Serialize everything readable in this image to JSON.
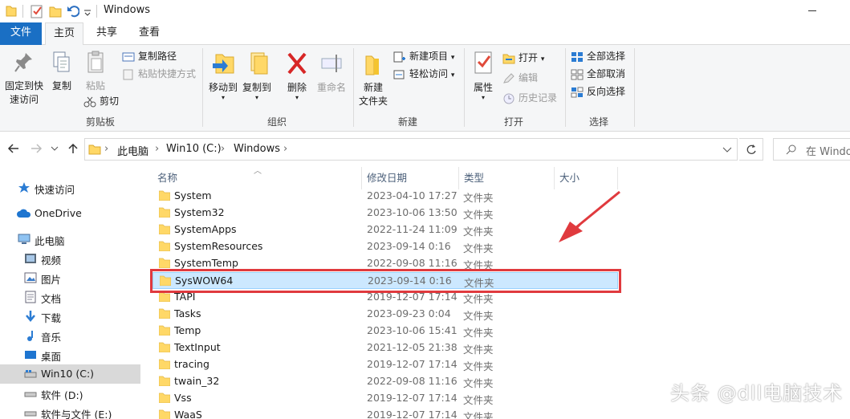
{
  "window": {
    "title": "Windows"
  },
  "ribbon_tabs": [
    "文件",
    "主页",
    "共享",
    "查看"
  ],
  "clipboard": {
    "pin_label_1": "固定到快",
    "pin_label_2": "速访问",
    "copy": "复制",
    "paste": "粘贴",
    "copy_path": "复制路径",
    "paste_shortcut": "粘贴快捷方式",
    "cut": "剪切",
    "group": "剪贴板"
  },
  "organize": {
    "move_to": "移动到",
    "copy_to": "复制到",
    "delete": "删除",
    "rename": "重命名",
    "group": "组织"
  },
  "new_group": {
    "new_folder_1": "新建",
    "new_folder_2": "文件夹",
    "new_item": "新建项目",
    "easy_access": "轻松访问",
    "group": "新建"
  },
  "open_group": {
    "properties": "属性",
    "open": "打开",
    "edit": "编辑",
    "history": "历史记录",
    "group": "打开"
  },
  "select_group": {
    "select_all": "全部选择",
    "select_none": "全部取消",
    "invert": "反向选择",
    "group": "选择"
  },
  "address": {
    "crumbs": [
      "此电脑",
      "Win10 (C:)",
      "Windows"
    ],
    "search_placeholder": "在 Windo"
  },
  "sidebar": {
    "items": [
      {
        "label": "快速访问",
        "icon": "star-icon"
      },
      {
        "label": "OneDrive",
        "icon": "cloud-icon"
      },
      {
        "label": "此电脑",
        "icon": "computer-icon"
      },
      {
        "label": "视频",
        "icon": "video-icon"
      },
      {
        "label": "图片",
        "icon": "picture-icon"
      },
      {
        "label": "文档",
        "icon": "document-icon"
      },
      {
        "label": "下载",
        "icon": "download-icon"
      },
      {
        "label": "音乐",
        "icon": "music-icon"
      },
      {
        "label": "桌面",
        "icon": "desktop-icon"
      },
      {
        "label": "Win10 (C:)",
        "icon": "drive-icon"
      },
      {
        "label": "软件 (D:)",
        "icon": "drive-icon"
      },
      {
        "label": "软件与文件 (E:)",
        "icon": "drive-icon"
      }
    ]
  },
  "columns": {
    "name": "名称",
    "date": "修改日期",
    "type": "类型",
    "size": "大小"
  },
  "files": [
    {
      "name": "System",
      "date": "2023-04-10 17:27",
      "type": "文件夹"
    },
    {
      "name": "System32",
      "date": "2023-10-06 13:50",
      "type": "文件夹"
    },
    {
      "name": "SystemApps",
      "date": "2022-11-24 11:09",
      "type": "文件夹"
    },
    {
      "name": "SystemResources",
      "date": "2023-09-14 0:16",
      "type": "文件夹"
    },
    {
      "name": "SystemTemp",
      "date": "2022-09-08 11:16",
      "type": "文件夹"
    },
    {
      "name": "SysWOW64",
      "date": "2023-09-14 0:16",
      "type": "文件夹",
      "selected": true
    },
    {
      "name": "TAPI",
      "date": "2019-12-07 17:14",
      "type": "文件夹"
    },
    {
      "name": "Tasks",
      "date": "2023-09-23 0:04",
      "type": "文件夹"
    },
    {
      "name": "Temp",
      "date": "2023-10-06 15:41",
      "type": "文件夹"
    },
    {
      "name": "TextInput",
      "date": "2021-12-05 21:38",
      "type": "文件夹"
    },
    {
      "name": "tracing",
      "date": "2019-12-07 17:14",
      "type": "文件夹"
    },
    {
      "name": "twain_32",
      "date": "2022-09-08 11:16",
      "type": "文件夹"
    },
    {
      "name": "Vss",
      "date": "2019-12-07 17:14",
      "type": "文件夹"
    },
    {
      "name": "WaaS",
      "date": "2019-12-07 17:14",
      "type": "文件夹"
    }
  ],
  "watermark": "头条 @dll电脑技术",
  "colors": {
    "accent": "#1a6fc4",
    "selection": "#cce8ff",
    "highlight": "#e03a3e",
    "folder": "#ffd867"
  }
}
